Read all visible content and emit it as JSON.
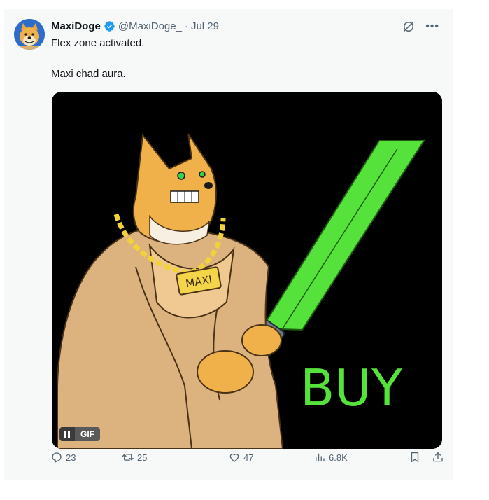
{
  "post": {
    "author_name": "MaxiDoge",
    "handle": "@MaxiDoge_",
    "separator": "·",
    "date": "Jul 29",
    "text_line1": "Flex zone activated.",
    "text_line2": "Maxi chad aura."
  },
  "media": {
    "chain_tag": "MAXI",
    "buy_text": "BUY",
    "gif_label": "GIF",
    "background": "#000000",
    "saber_color": "#55e23a"
  },
  "actions": {
    "replies": "23",
    "reposts": "25",
    "likes": "47",
    "views": "6.8K"
  },
  "icons": {
    "verified": "verified-badge-icon",
    "grok": "grok-icon",
    "more": "more-icon",
    "reply": "reply-icon",
    "retweet": "retweet-icon",
    "like": "heart-icon",
    "views": "views-icon",
    "bookmark": "bookmark-icon",
    "share": "share-icon"
  },
  "colors": {
    "verified_blue": "#1d9bf0",
    "muted_text": "#536471"
  }
}
